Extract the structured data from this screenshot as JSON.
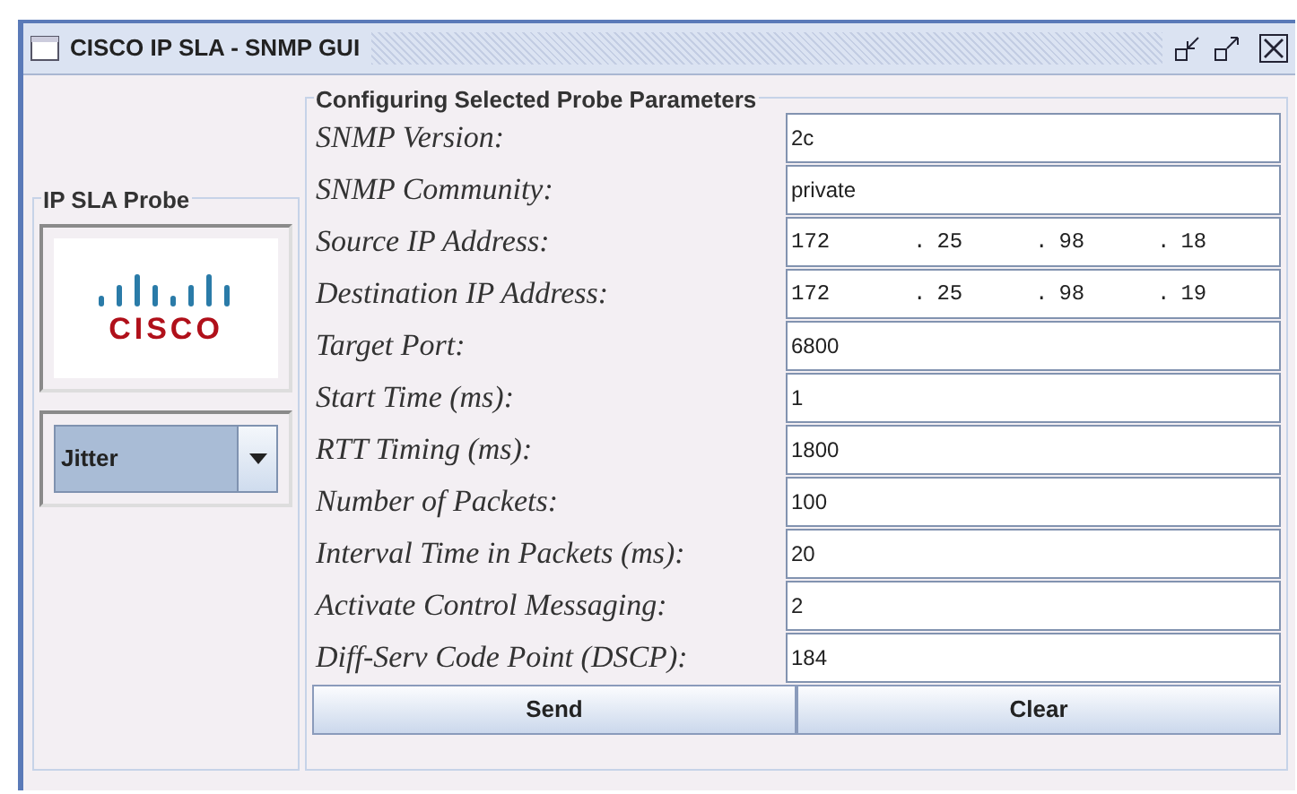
{
  "window": {
    "title": "CISCO IP SLA - SNMP GUI"
  },
  "probe_panel": {
    "title": "IP SLA Probe",
    "logo_text": "CISCO",
    "probe_type": "Jitter"
  },
  "parameters": {
    "title": "Configuring Selected Probe Parameters",
    "rows": [
      {
        "label": "SNMP Version:",
        "kind": "text",
        "value": "2c"
      },
      {
        "label": "SNMP Community:",
        "kind": "text",
        "value": "private"
      },
      {
        "label": "Source IP Address:",
        "kind": "ip",
        "separator": ".",
        "octets": [
          "172",
          "25",
          "98",
          "18"
        ]
      },
      {
        "label": "Destination IP Address:",
        "kind": "ip",
        "separator": ".",
        "octets": [
          "172",
          "25",
          "98",
          "19"
        ]
      },
      {
        "label": "Target Port:",
        "kind": "text",
        "value": "6800"
      },
      {
        "label": "Start Time (ms):",
        "kind": "text",
        "value": "1"
      },
      {
        "label": "RTT Timing (ms):",
        "kind": "text",
        "value": "1800"
      },
      {
        "label": "Number of Packets:",
        "kind": "text",
        "value": "100"
      },
      {
        "label": "Interval Time in Packets (ms):",
        "kind": "text",
        "value": "20"
      },
      {
        "label": "Activate Control Messaging:",
        "kind": "text",
        "value": "2"
      },
      {
        "label": "Diff-Serv Code Point (DSCP):",
        "kind": "text",
        "value": "184"
      }
    ]
  },
  "buttons": [
    "Send",
    "Clear"
  ]
}
